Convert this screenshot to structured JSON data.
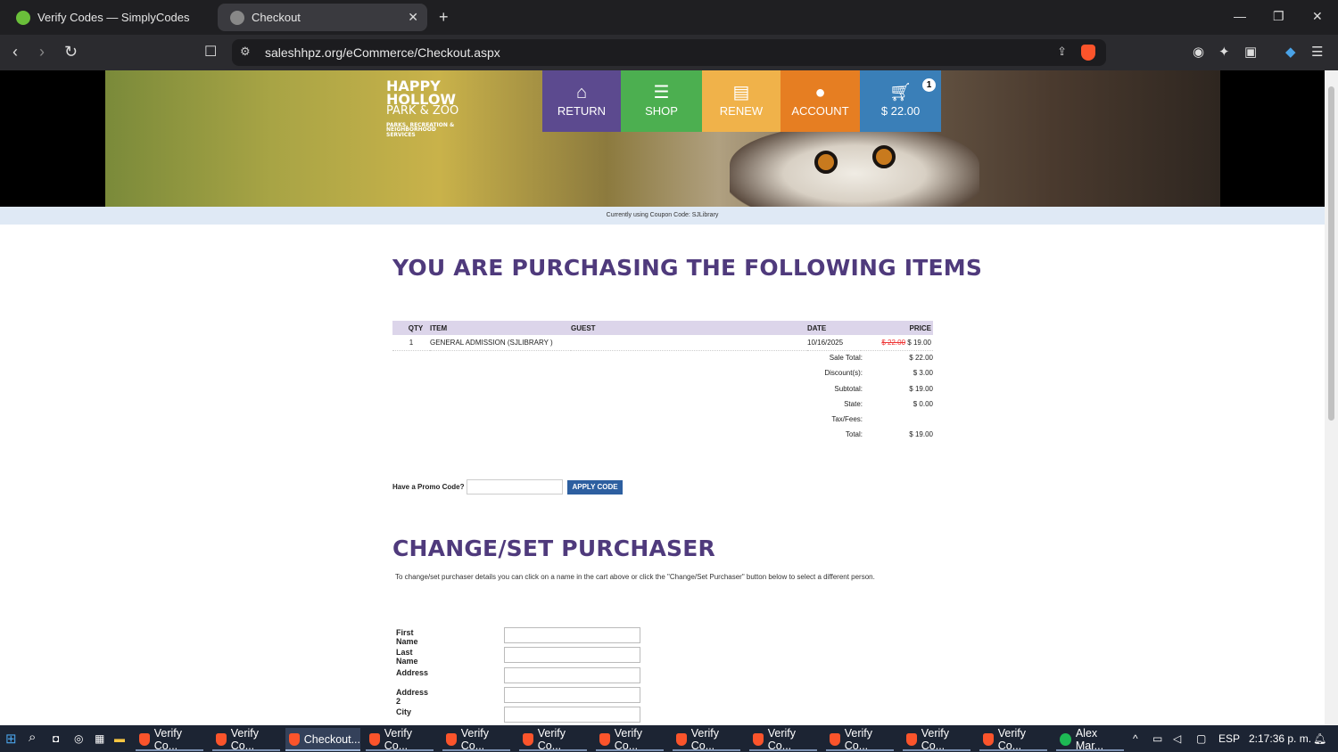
{
  "browser": {
    "tabs": [
      {
        "title": "Verify Codes — SimplyCodes"
      },
      {
        "title": "Checkout"
      }
    ],
    "url": "saleshhpz.org/eCommerce/Checkout.aspx"
  },
  "site": {
    "logo": {
      "line1": "HAPPY",
      "line2": "HOLLOW",
      "line3": "PARK & ZOO",
      "line4": "PARKS, RECREATION & NEIGHBORHOOD SERVICES"
    },
    "nav": [
      {
        "label": "RETURN",
        "icon": "home-icon",
        "color": "#5c4a8f"
      },
      {
        "label": "SHOP",
        "icon": "menu-icon",
        "color": "#4caf50"
      },
      {
        "label": "RENEW",
        "icon": "id-card-icon",
        "color": "#f0b24a"
      },
      {
        "label": "ACCOUNT",
        "icon": "user-icon",
        "color": "#e67e22"
      },
      {
        "label": "$ 22.00",
        "icon": "cart-icon",
        "color": "#3a7fb8",
        "badge": "1"
      }
    ],
    "coupon_notice": "Currently using Coupon Code: SJLibrary"
  },
  "cart": {
    "heading": "YOU ARE PURCHASING THE FOLLOWING ITEMS",
    "columns": {
      "qty": "QTY",
      "item": "ITEM",
      "guest": "GUEST",
      "date": "DATE",
      "price": "PRICE"
    },
    "rows": [
      {
        "qty": "1",
        "item": "GENERAL ADMISSION (SJLIBRARY )",
        "guest": "",
        "date": "10/16/2025",
        "old_price": "$ 22.00",
        "price": "$ 19.00"
      }
    ],
    "totals": [
      {
        "label": "Sale Total:",
        "value": "$ 22.00"
      },
      {
        "label": "Discount(s):",
        "value": "$ 3.00"
      },
      {
        "label": "Subtotal:",
        "value": "$ 19.00"
      },
      {
        "label": "State:",
        "value": "$ 0.00"
      },
      {
        "label": "Tax/Fees:",
        "value": ""
      },
      {
        "label": "Total:",
        "value": "$ 19.00"
      }
    ]
  },
  "promo": {
    "label": "Have a Promo Code?",
    "value": "",
    "button": "APPLY CODE"
  },
  "purchaser": {
    "heading": "CHANGE/SET PURCHASER",
    "description": "To change/set purchaser details you can click on a name in the cart above or click the \"Change/Set Purchaser\" button below to select a different person.",
    "fields": [
      {
        "label": "First Name",
        "value": ""
      },
      {
        "label": "Last Name",
        "value": ""
      },
      {
        "label": "Address",
        "value": ""
      },
      {
        "label": "Address 2",
        "value": ""
      },
      {
        "label": "City",
        "value": ""
      }
    ]
  },
  "taskbar": {
    "items": [
      "Verify Co...",
      "Verify Co...",
      "Checkout...",
      "Verify Co...",
      "Verify Co...",
      "Verify Co...",
      "Verify Co...",
      "Verify Co...",
      "Verify Co...",
      "Verify Co...",
      "Verify Co...",
      "Verify Co...",
      "Alex Mar..."
    ],
    "language": "ESP",
    "time": "2:17:36 p. m."
  }
}
